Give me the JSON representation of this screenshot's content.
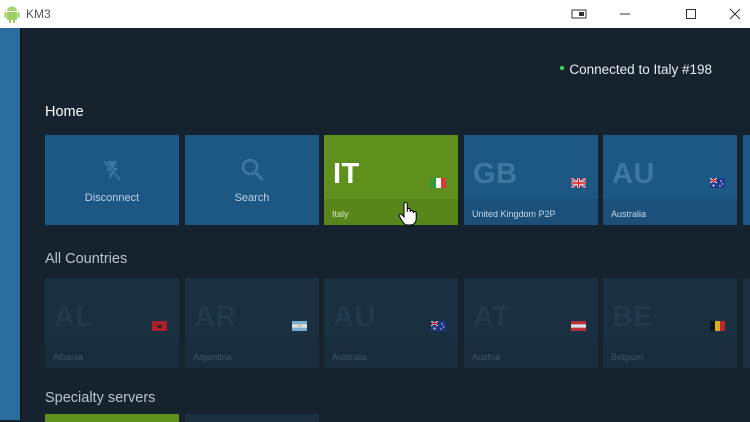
{
  "window": {
    "title": "KM3",
    "icons": {
      "app": "android-icon",
      "extra": "window-mode-icon",
      "minimize": "minimize-icon",
      "maximize": "maximize-icon",
      "close": "close-icon"
    }
  },
  "status": {
    "text": "Connected to Italy #198",
    "dot_color": "#3ddc5a"
  },
  "sections": {
    "home": "Home",
    "all_countries": "All Countries",
    "specialty": "Specialty servers"
  },
  "home": {
    "actions": [
      {
        "label": "Disconnect",
        "icon": "flash-off-icon"
      },
      {
        "label": "Search",
        "icon": "search-icon"
      }
    ],
    "servers": [
      {
        "code": "IT",
        "country": "Italy",
        "flag": "italy-flag-icon",
        "active": true
      },
      {
        "code": "GB",
        "country": "United Kingdom P2P",
        "flag": "uk-flag-icon",
        "active": false
      },
      {
        "code": "AU",
        "country": "Australia",
        "flag": "australia-flag-icon",
        "active": false
      }
    ]
  },
  "countries": [
    {
      "code": "AL",
      "country": "Albania",
      "flag": "albania-flag-icon"
    },
    {
      "code": "AR",
      "country": "Argentina",
      "flag": "argentina-flag-icon"
    },
    {
      "code": "AU",
      "country": "Australia",
      "flag": "australia-flag-icon"
    },
    {
      "code": "AT",
      "country": "Austria",
      "flag": "austria-flag-icon"
    },
    {
      "code": "BE",
      "country": "Belgium",
      "flag": "belgium-flag-icon"
    }
  ],
  "colors": {
    "background": "#16222e",
    "accent_blue": "#2b6d9e",
    "tile_blue": "#1d5783",
    "active_green": "#5f8f1d",
    "country_tile": "#1a2f40"
  }
}
